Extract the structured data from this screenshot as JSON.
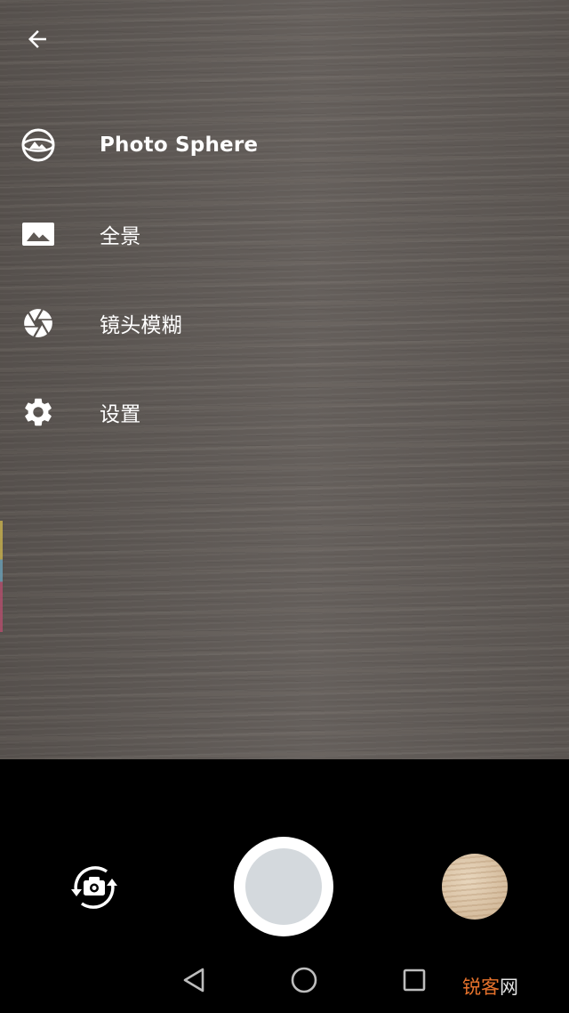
{
  "menu": {
    "items": [
      {
        "label": "Photo Sphere",
        "icon": "photo-sphere-icon"
      },
      {
        "label": "全景",
        "icon": "panorama-icon"
      },
      {
        "label": "镜头模糊",
        "icon": "lens-blur-icon"
      },
      {
        "label": "设置",
        "icon": "gear-icon"
      }
    ]
  },
  "controls": {
    "switch_camera_icon": "switch-camera-icon",
    "shutter_icon": "shutter-button",
    "thumbnail": "last-photo-thumbnail"
  },
  "navbar": {
    "back_icon": "nav-back-triangle-icon",
    "home_icon": "nav-home-circle-icon",
    "recent_icon": "nav-recent-square-icon"
  },
  "watermark": {
    "part1": "锐客",
    "part2": "网"
  },
  "colors": {
    "viewfinder": "#5f5955",
    "shutter_inner": "#d4d9dd",
    "watermark_accent": "#e8732c"
  }
}
